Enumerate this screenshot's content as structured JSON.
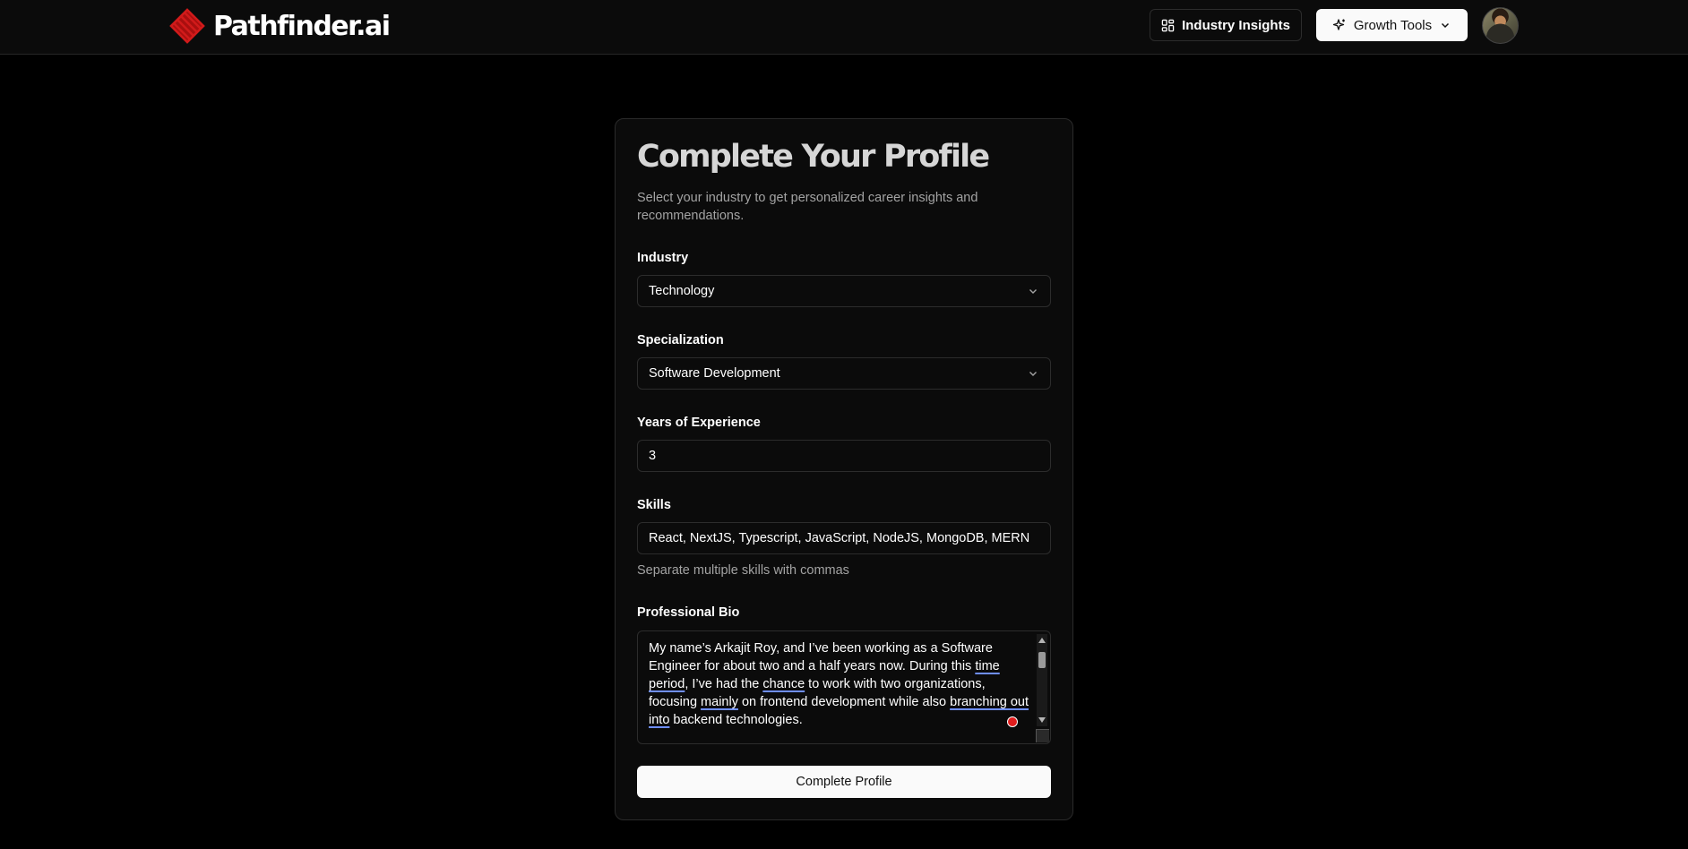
{
  "header": {
    "brand": "Pathfinder.ai",
    "brand_color": "#d11a1a",
    "logo_icon": "layered-diamond-logo-icon",
    "industry_insights_label": "Industry Insights",
    "industry_insights_icon": "grid-dashboard-icon",
    "growth_tools_label": "Growth Tools",
    "growth_tools_icon": "sparkles-icon",
    "growth_tools_chevron": "chevron-down-icon",
    "avatar_icon": "user-avatar"
  },
  "form": {
    "title": "Complete Your Profile",
    "subtitle": "Select your industry to get personalized career insights and recommendations.",
    "industry": {
      "label": "Industry",
      "value": "Technology"
    },
    "specialization": {
      "label": "Specialization",
      "value": "Software Development"
    },
    "experience": {
      "label": "Years of Experience",
      "value": "3"
    },
    "skills": {
      "label": "Skills",
      "value": "React, NextJS, Typescript, JavaScript, NodeJS, MongoDB, MERN",
      "helper": "Separate multiple skills with commas"
    },
    "bio": {
      "label": "Professional Bio",
      "value": {
        "p1": "My name’s Arkajit Roy, and I’ve been working as a Software Engineer for about two and a half years now. During this ",
        "s1": "time period",
        "p2": ", I’ve had the ",
        "s2": "chance",
        "p3": " to work with two organizations, focusing ",
        "s3": "mainly",
        "p4": " on frontend development while also ",
        "s4": "branching out into",
        "p5": " backend technologies."
      },
      "suggestion_underline_color": "#6f8fff",
      "grammar_indicator_color": "#e11d1d"
    },
    "submit_label": "Complete Profile"
  }
}
